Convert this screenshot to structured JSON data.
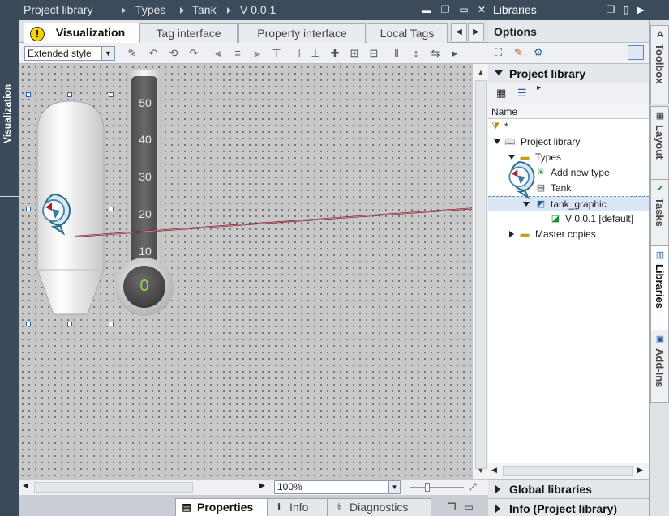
{
  "left_strip": {
    "label": "Visualization"
  },
  "editor_title": {
    "crumbs": [
      "Project library",
      "Types",
      "Tank",
      "V 0.0.1"
    ]
  },
  "tabs": [
    {
      "label": "Visualization",
      "active": true
    },
    {
      "label": "Tag interface",
      "active": false
    },
    {
      "label": "Property interface",
      "active": false
    },
    {
      "label": "Local Tags",
      "active": false
    }
  ],
  "toolbar": {
    "style_value": "Extended style"
  },
  "thermometer": {
    "ticks": [
      "50",
      "40",
      "30",
      "20",
      "10"
    ],
    "value": "0"
  },
  "zoom": {
    "value": "100%"
  },
  "status_tabs": [
    {
      "label": "Properties",
      "active": true
    },
    {
      "label": "Info",
      "active": false
    },
    {
      "label": "Diagnostics",
      "active": false
    }
  ],
  "libraries": {
    "title": "Libraries",
    "options_label": "Options",
    "project_library_label": "Project library",
    "name_header": "Name",
    "filter_value": "*",
    "tree": [
      {
        "label": "Project library",
        "level": 0,
        "expanded": true
      },
      {
        "label": "Types",
        "level": 1,
        "expanded": true
      },
      {
        "label": "Add new type",
        "level": 2
      },
      {
        "label": "Tank",
        "level": 2
      },
      {
        "label": "tank_graphic",
        "level": 2,
        "expanded": true,
        "selected": true
      },
      {
        "label": "V 0.0.1 [default]",
        "level": 3
      },
      {
        "label": "Master copies",
        "level": 1,
        "expanded": false
      }
    ],
    "global_libraries_label": "Global libraries",
    "info_label": "Info (Project library)"
  },
  "side_tabs": [
    "Toolbox",
    "Layout",
    "Tasks",
    "Libraries",
    "Add-Ins"
  ],
  "colors": {
    "title_bar": "#3c4b5b",
    "canvas": "#c8c8c8",
    "link_line": "#7a1a2a"
  }
}
